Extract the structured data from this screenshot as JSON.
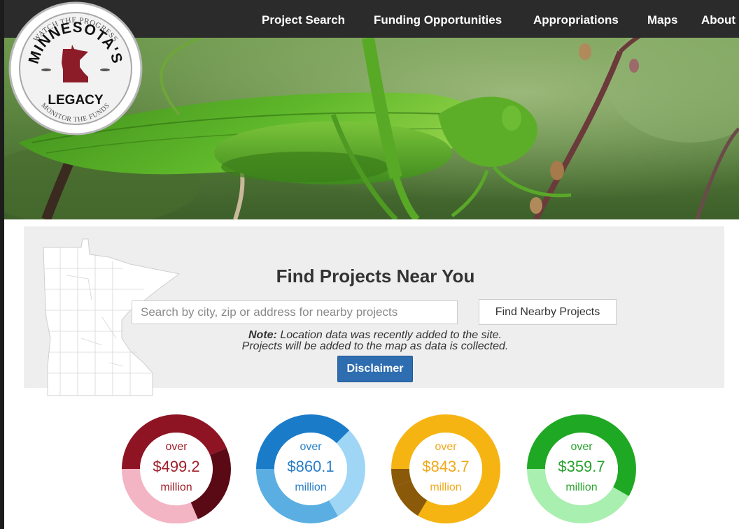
{
  "nav": {
    "items": [
      {
        "label": "Project Search"
      },
      {
        "label": "Funding Opportunities"
      },
      {
        "label": "Appropriations"
      },
      {
        "label": "Maps"
      },
      {
        "label": "About"
      }
    ]
  },
  "logo": {
    "top_text": "WATCH THE PROGRESS",
    "title": "MINNESOTA'S",
    "subtitle": "LEGACY",
    "bottom_text": "MONITOR THE FUNDS"
  },
  "finder": {
    "title": "Find Projects Near You",
    "search_placeholder": "Search by city, zip or address for nearby projects",
    "find_button": "Find Nearby Projects",
    "note_label": "Note:",
    "note_line1": " Location data was recently added to the site.",
    "note_line2": "Projects will be added to the map as data is collected.",
    "disclaimer_button": "Disclaimer"
  },
  "stats": [
    {
      "over": "over",
      "amount": "$499.2",
      "unit": "million",
      "text_color": "#a0202a",
      "colors": [
        "#8e1424",
        "#5a0a14",
        "#f3b4c4"
      ]
    },
    {
      "over": "over",
      "amount": "$860.1",
      "unit": "million",
      "text_color": "#2a7fc8",
      "colors": [
        "#1a7bc9",
        "#9fd6f5",
        "#5aaee2"
      ]
    },
    {
      "over": "over",
      "amount": "$843.7",
      "unit": "million",
      "text_color": "#f0a91a",
      "colors": [
        "#f6b413",
        "#f6b413",
        "#8a5a0a"
      ]
    },
    {
      "over": "over",
      "amount": "$359.7",
      "unit": "million",
      "text_color": "#29a12d",
      "colors": [
        "#1fa824",
        "#1fa824",
        "#a8efb0"
      ]
    }
  ]
}
